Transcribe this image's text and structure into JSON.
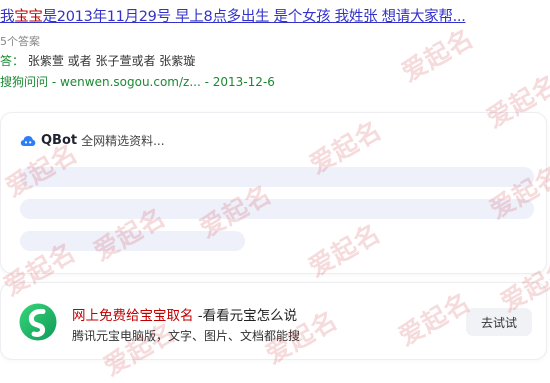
{
  "result": {
    "title_prefix": "我",
    "title_highlight": "宝宝",
    "title_rest": "是2013年11月29号 早上8点多出生 是个女孩 我姓张 想请大家帮...",
    "answer_count": "5个答案",
    "answer_prefix": "答：",
    "answer_text": "张紫萱 或者 张子萱或者 张紫璇",
    "source_name": "搜狗问问",
    "source_url": " - wenwen.sogou.com/z... - 2013-12-6"
  },
  "qbot": {
    "logo_icon": "qbot-cloud-icon",
    "name": "QBot",
    "description": "全网精选资料..."
  },
  "promo": {
    "logo_icon": "yuanbao-logo-icon",
    "title_link": "网上免费给宝宝取名",
    "title_rest": " -看看元宝怎么说",
    "description": "腾讯元宝电脑版，文字、图片、文档都能搜",
    "button_label": "去试试"
  },
  "watermark": {
    "text": "爱起名",
    "color": "#c82832"
  },
  "colors": {
    "link": "#3333cc",
    "highlight": "#c00000",
    "source": "#1a8a32",
    "skeleton": "#eef0fa"
  }
}
